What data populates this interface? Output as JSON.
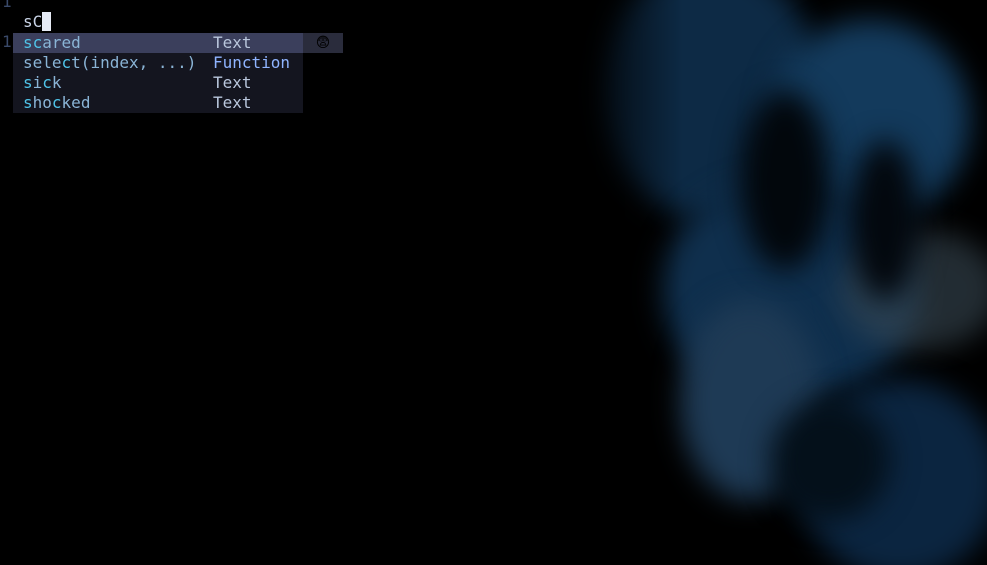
{
  "gutter": {
    "line_top": "1",
    "line_second": "1"
  },
  "editor": {
    "typed_prefix": "s",
    "typed_char": "C"
  },
  "completion": {
    "items": [
      {
        "word_match": "sc",
        "word_rest": "ared",
        "kind": "Text"
      },
      {
        "word_a": "sele",
        "word_match": "c",
        "word_rest": "t(index, ...)",
        "kind": "Function"
      },
      {
        "word_match": "s",
        "word_mid": "i",
        "word_match2": "c",
        "word_rest": "k",
        "kind": "Text"
      },
      {
        "word_match": "s",
        "word_mid": "ho",
        "word_match2": "c",
        "word_rest": "ked",
        "kind": "Text"
      }
    ],
    "preview_emoji": "😨"
  },
  "colors": {
    "background": "#000000",
    "popup_bg": "#14151f",
    "selected_bg": "#3b3f5c",
    "match": "#4fc3e8",
    "function_kind": "#8fb4ff"
  }
}
